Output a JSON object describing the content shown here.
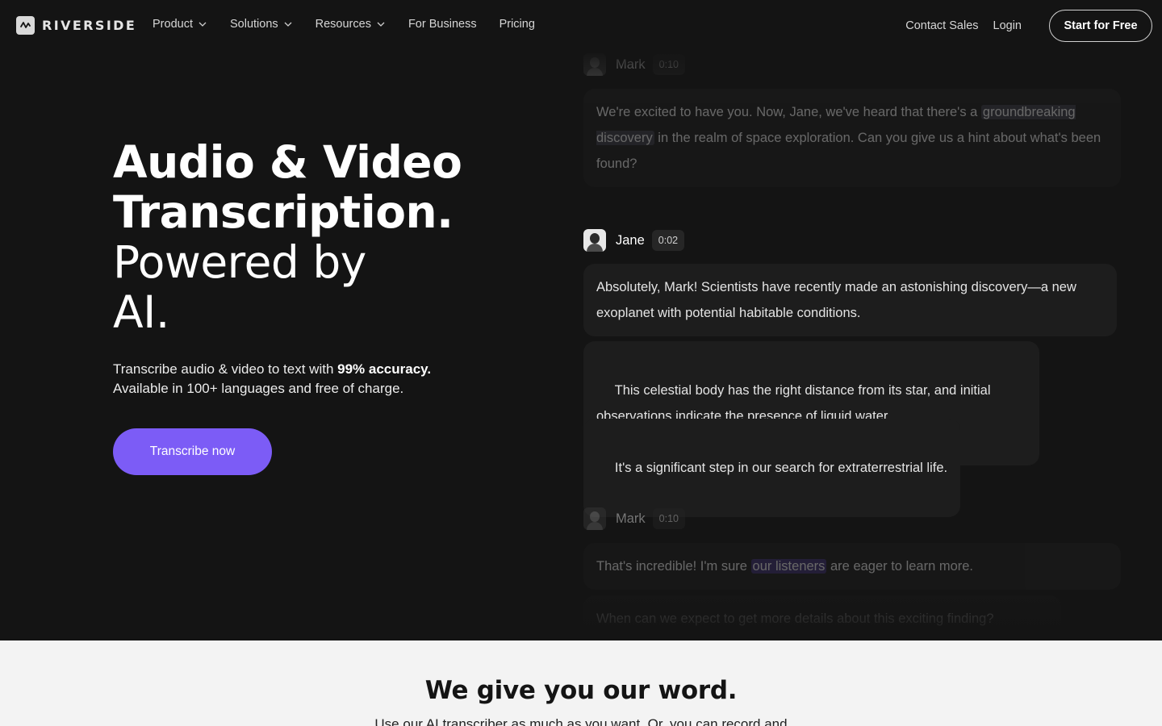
{
  "brand": {
    "name": "RIVERSIDE"
  },
  "nav": {
    "links": [
      {
        "label": "Product",
        "dropdown": true
      },
      {
        "label": "Solutions",
        "dropdown": true
      },
      {
        "label": "Resources",
        "dropdown": true
      },
      {
        "label": "For Business",
        "dropdown": false
      },
      {
        "label": "Pricing",
        "dropdown": false
      }
    ],
    "contact_sales": "Contact Sales",
    "login": "Login",
    "start_free": "Start for Free"
  },
  "hero": {
    "title_line1": "Audio & Video",
    "title_line2": "Transcription.",
    "title_line3": "Powered by",
    "title_line4": "AI.",
    "sub_pre": "Transcribe audio & video to text with ",
    "sub_bold": "99% accuracy.",
    "sub_line2": "Available in 100+ languages and free of charge.",
    "cta": "Transcribe now"
  },
  "transcript": {
    "blocks": [
      {
        "speaker": "Mark",
        "time": "0:10",
        "bubble": {
          "pre": "We're excited to have you. Now, Jane, we've heard that there's a ",
          "highlight": "groundbreaking discovery",
          "post": " in the realm of space exploration. Can you give us a hint about what's been found?"
        }
      },
      {
        "speaker": "Jane",
        "time": "0:02",
        "bubbles": [
          "Absolutely, Mark! Scientists have recently made an astonishing discovery—a new exoplanet with potential habitable conditions.",
          " This celestial body has the right distance from its star, and initial observations indicate the presence of liquid water.",
          " It's a significant step in our search for extraterrestrial life."
        ]
      },
      {
        "speaker": "Mark",
        "time": "0:10",
        "bubble": {
          "pre": "That's incredible! I'm sure ",
          "highlight": "our listeners",
          "post": " are eager to learn more."
        },
        "bubble2": "When can we expect to get more details about this exciting finding?"
      }
    ]
  },
  "bottom": {
    "title": "We give you our word.",
    "subtitle": "Use our AI transcriber as much as you want. Or, you can record and"
  },
  "colors": {
    "accent": "#7c5cf6",
    "background": "#141414",
    "bottom_bg": "#f3f3f3"
  }
}
